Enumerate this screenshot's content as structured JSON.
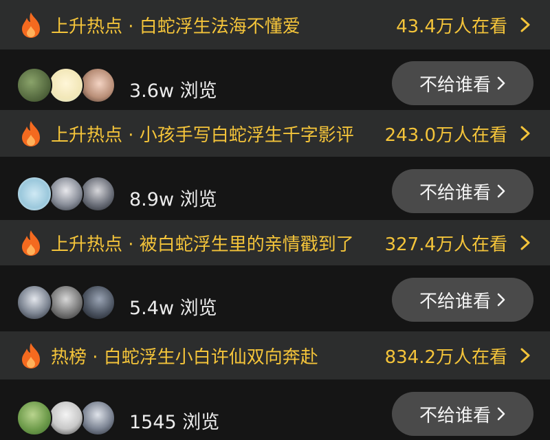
{
  "items": [
    {
      "hot_title": "上升热点 · 白蛇浮生法海不懂爱",
      "viewers": "43.4万人在看",
      "views": "3.6w 浏览",
      "button_label": "不给谁看",
      "avatars": [
        "forest-photo-avatar",
        "cartoon-girl-avatar",
        "girl-selfie-avatar"
      ]
    },
    {
      "hot_title": "上升热点 · 小孩手写白蛇浮生千字影评",
      "viewers": "243.0万人在看",
      "views": "8.9w 浏览",
      "button_label": "不给谁看",
      "avatars": [
        "cartoon-cat-avatar",
        "anime-character-avatar",
        "anime-character-avatar"
      ]
    },
    {
      "hot_title": "上升热点 · 被白蛇浮生里的亲情戳到了",
      "viewers": "327.4万人在看",
      "views": "5.4w 浏览",
      "button_label": "不给谁看",
      "avatars": [
        "anime-character-avatar",
        "anime-character-avatar",
        "dark-portrait-avatar"
      ]
    },
    {
      "hot_title": "热榜 · 白蛇浮生小白许仙双向奔赴",
      "viewers": "834.2万人在看",
      "views": "1545 浏览",
      "button_label": "不给谁看",
      "avatars": [
        "tree-photo-avatar",
        "person-photo-avatar",
        "anime-character-avatar"
      ]
    }
  ],
  "colors": {
    "background": "#151515",
    "hot_bar": "#2c2d2d",
    "accent_yellow": "#f4c43a",
    "flame_orange": "#f46a1f",
    "button_bg": "#4a4a4a"
  }
}
